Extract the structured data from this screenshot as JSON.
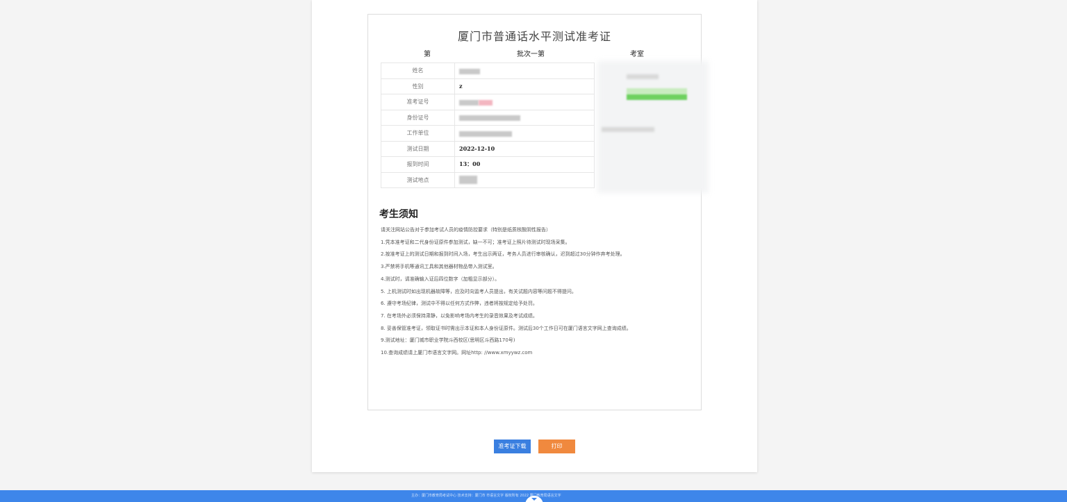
{
  "ticket": {
    "title": "厦门市普通话水平测试准考证",
    "batch_label_prefix": "第",
    "batch_number": "批次一第",
    "exam_room_label": "考室"
  },
  "info_rows": [
    {
      "label": "姓名",
      "value": ""
    },
    {
      "label": "性别",
      "value": "z"
    },
    {
      "label": "准考证号",
      "value": ""
    },
    {
      "label": "身份证号",
      "value": ""
    },
    {
      "label": "工作单位",
      "value": ""
    },
    {
      "label": "测试日期",
      "value": "2022-12-10"
    },
    {
      "label": "报到时间",
      "value": "13：00"
    },
    {
      "label": "测试地点",
      "value": ""
    }
  ],
  "notice": {
    "title": "考生须知",
    "items": [
      "请关注网站公告对于参加考试人员的疫情防控要求（特别是纸质核酸阴性报告）",
      "1.凭本准考证和二代身份证原件参加测试，缺一不可；准考证上照片待测试时现场采集。",
      "2.按准考证上的测试日期和报到时间入场，考生出示两证，考务人员进行审核确认，迟到超过30分钟作弃考处理。",
      "3.严禁将手机等通讯工具和其他器材物品带入测试室。",
      "4.测试时，请准确输入证后四位数字（加粗显示部分）。",
      "5. 上机测试时如出现机器故障等，应及时向监考人员提出，有关试题内容等问题不得提问。",
      "6. 遵守考场纪律，测试中不得以任何方式作弊，违者将按规定给予处罚。",
      "7. 在考场外必须保持肃静，以免影响考场内考生的录音效果及考试成绩。",
      "8. 妥善保管准考证，领取证书时需出示本证和本人身份证原件。测试后30个工作日可在厦门语言文字网上查询成绩。",
      "9.测试地址：厦门城市职业学院斗西校区(思明区斗西路170号)",
      "10.查询成绩请上厦门市语言文字网。网址http: //www.xmyywz.com"
    ]
  },
  "buttons": {
    "download": "准考证下载",
    "print": "打印"
  },
  "footer": {
    "text": "主办：厦门市教育局考试中心    技术支持：厦门市     市语言文字    版权所有 2022 厦门教育局语言文字"
  }
}
